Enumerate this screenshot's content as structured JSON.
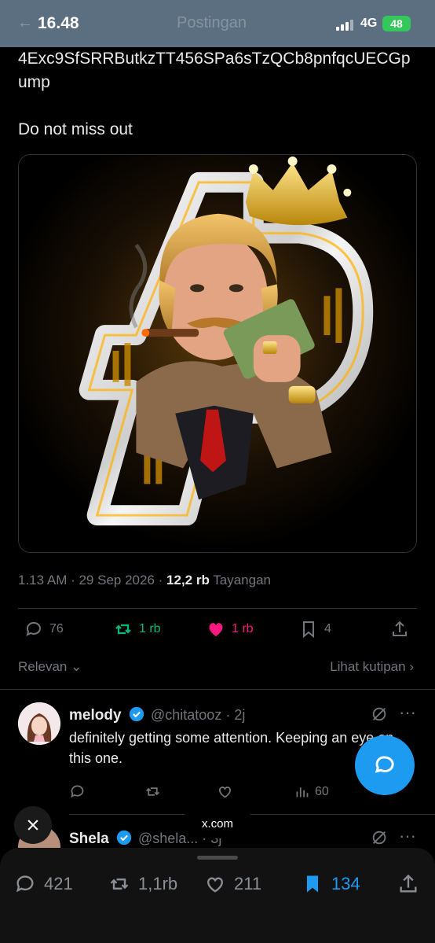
{
  "status": {
    "time": "16.48",
    "network": "4G",
    "battery": "48",
    "header_title": "Postingan"
  },
  "tweet": {
    "text": "4Exc9SfSRRButkzTT456SPa6sTzQCb8pnfqcUECGpump",
    "cta": "Do not miss out",
    "time": "1.13 AM · 29 Sep 2026 ·",
    "views": "12,2 rb",
    "views_label": "Tayangan"
  },
  "actions": {
    "replies": "76",
    "retweets": "1 rb",
    "likes": "1 rb",
    "bookmarks": "4"
  },
  "sort": {
    "left": "Relevan",
    "right": "Lihat kutipan"
  },
  "replies": [
    {
      "name": "melody",
      "handle": "@chitatooz · 2j",
      "text": "definitely getting some attention. Keeping an eye on this one.",
      "views": "60"
    },
    {
      "name": "Shela",
      "handle": "@shela...  · 3j",
      "text": "",
      "views": ""
    }
  ],
  "overlay": {
    "domain": "x.com"
  },
  "bottom_bar": {
    "replies": "421",
    "retweets": "1,1rb",
    "likes": "211",
    "bookmarks": "134"
  },
  "colors": {
    "accent": "#1d9bf0",
    "like": "#f91880",
    "retweet": "#00ba7c",
    "muted": "#71767b"
  }
}
